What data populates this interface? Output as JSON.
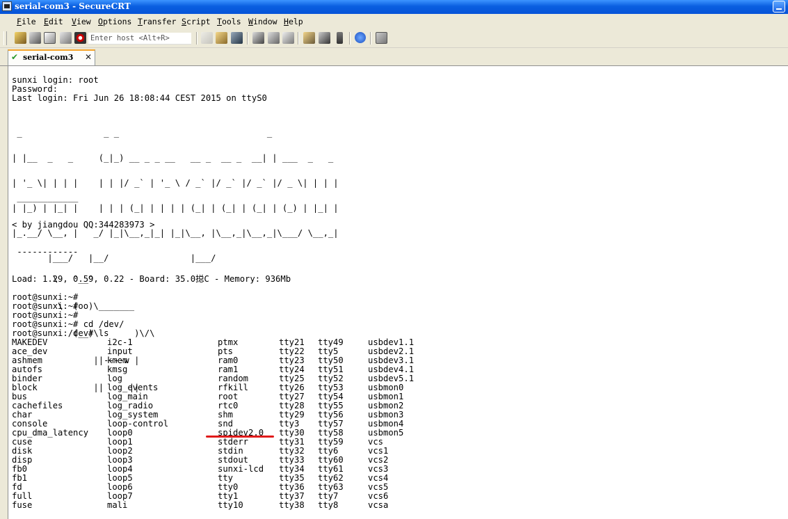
{
  "window": {
    "title": "serial-com3 - SecureCRT"
  },
  "menu": [
    "File",
    "Edit",
    "View",
    "Options",
    "Transfer",
    "Script",
    "Tools",
    "Window",
    "Help"
  ],
  "toolbar": {
    "host_placeholder": "Enter host <Alt+R>"
  },
  "tab": {
    "label": "serial-com3",
    "status_icon": "check-icon",
    "close_icon": "close-icon"
  },
  "colors": {
    "titlebar": "#0a5fe0",
    "underline_mark": "#e01a1a"
  },
  "terminal": {
    "header_lines": [
      "sunxi login: root",
      "Password:",
      "Last login: Fri Jun 26 18:08:44 CEST 2015 on ttyS0"
    ],
    "banner_art": [
      " _                _ _                             _             ",
      "| |__  _   _     (_|_) __ _ _ __   __ _  __ _  __| | ___  _   _ ",
      "| '_ \\| | | |    | | |/ _` | '_ \\ / _` |/ _` |/ _` |/ _ \\| | | |",
      "| |_) | |_| |    | | | (_| | | | | (_| | (_| | (_| | (_) | |_| |",
      "|_.__/ \\__, |   _/ |_|\\__,_|_| |_|\\__, |\\__,_|\\__,_|\\___/ \\__,_|",
      "       |___/   |__/                |___/                         "
    ],
    "cowsay": [
      " ____________",
      "< by jiangdou QQ:344283973 >",
      " ------------",
      "        \\   ^__^",
      "         \\  (oo)\\_______",
      "            (__)\\       )\\/\\",
      "                ||----w |",
      "                ||     ||"
    ],
    "status_line": "Load: 1.29, 0.59, 0.22 - Board: 35.0搃C - Memory: 936Mb",
    "prompts": [
      "root@sunxi:~#",
      "root@sunxi:~#",
      "root@sunxi:~#",
      "root@sunxi:~# cd /dev/",
      "root@sunxi:/dev# ls"
    ],
    "ls_rows": [
      [
        "MAKEDEV",
        "i2c-1",
        "ptmx",
        "tty21",
        "tty49",
        "usbdev1.1"
      ],
      [
        "ace_dev",
        "input",
        "pts",
        "tty22",
        "tty5",
        "usbdev2.1"
      ],
      [
        "ashmem",
        "kmem",
        "ram0",
        "tty23",
        "tty50",
        "usbdev3.1"
      ],
      [
        "autofs",
        "kmsg",
        "ram1",
        "tty24",
        "tty51",
        "usbdev4.1"
      ],
      [
        "binder",
        "log",
        "random",
        "tty25",
        "tty52",
        "usbdev5.1"
      ],
      [
        "block",
        "log_events",
        "rfkill",
        "tty26",
        "tty53",
        "usbmon0"
      ],
      [
        "bus",
        "log_main",
        "root",
        "tty27",
        "tty54",
        "usbmon1"
      ],
      [
        "cachefiles",
        "log_radio",
        "rtc0",
        "tty28",
        "tty55",
        "usbmon2"
      ],
      [
        "char",
        "log_system",
        "shm",
        "tty29",
        "tty56",
        "usbmon3"
      ],
      [
        "console",
        "loop-control",
        "snd",
        "tty3",
        "tty57",
        "usbmon4"
      ],
      [
        "cpu_dma_latency",
        "loop0",
        "spidev2.0",
        "tty30",
        "tty58",
        "usbmon5"
      ],
      [
        "cuse",
        "loop1",
        "stderr",
        "tty31",
        "tty59",
        "vcs"
      ],
      [
        "disk",
        "loop2",
        "stdin",
        "tty32",
        "tty6",
        "vcs1"
      ],
      [
        "disp",
        "loop3",
        "stdout",
        "tty33",
        "tty60",
        "vcs2"
      ],
      [
        "fb0",
        "loop4",
        "sunxi-lcd",
        "tty34",
        "tty61",
        "vcs3"
      ],
      [
        "fb1",
        "loop5",
        "tty",
        "tty35",
        "tty62",
        "vcs4"
      ],
      [
        "fd",
        "loop6",
        "tty0",
        "tty36",
        "tty63",
        "vcs5"
      ],
      [
        "full",
        "loop7",
        "tty1",
        "tty37",
        "tty7",
        "vcs6"
      ],
      [
        "fuse",
        "mali",
        "tty10",
        "tty38",
        "tty8",
        "vcsa"
      ]
    ]
  }
}
